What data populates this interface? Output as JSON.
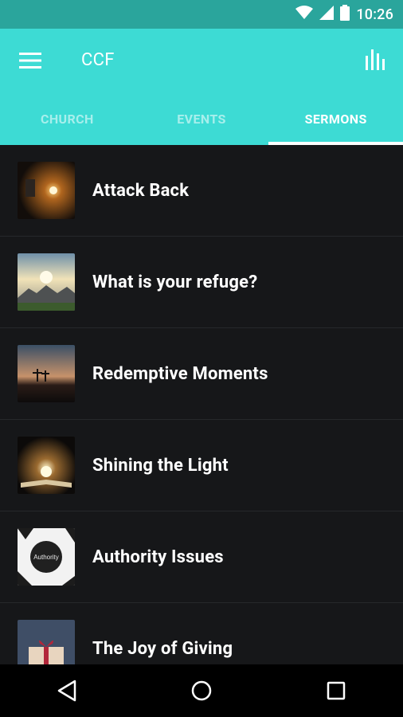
{
  "status_bar": {
    "time": "10:26",
    "icons": [
      "wifi-icon",
      "signal-icon",
      "battery-icon"
    ]
  },
  "app_bar": {
    "title": "CCF",
    "menu_icon": "hamburger-menu-icon",
    "action_icon": "bar-chart-icon"
  },
  "tabs": [
    {
      "label": "CHURCH",
      "active": false
    },
    {
      "label": "EVENTS",
      "active": false
    },
    {
      "label": "SERMONS",
      "active": true
    }
  ],
  "sermons": [
    {
      "title": "Attack Back"
    },
    {
      "title": "What is your refuge?"
    },
    {
      "title": "Redemptive Moments"
    },
    {
      "title": "Shining the Light"
    },
    {
      "title": "Authority Issues",
      "thumb_text": "Authority"
    },
    {
      "title": "The Joy of Giving"
    }
  ],
  "nav_bar": {
    "buttons": [
      "back-icon",
      "home-icon",
      "recents-icon"
    ]
  },
  "colors": {
    "primary": "#3ddbd4",
    "status_bar": "#2aa59c",
    "background": "#161719"
  }
}
